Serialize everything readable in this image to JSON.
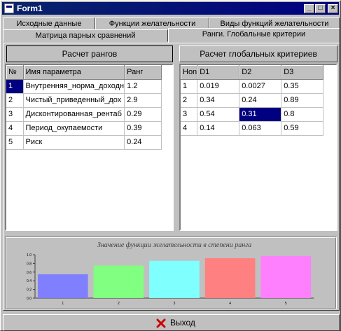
{
  "window": {
    "title": "Form1"
  },
  "title_buttons": {
    "minimize": "_",
    "maximize": "□",
    "close": "×"
  },
  "tabs_row1": [
    "Исходные данные",
    "Функции желательности",
    "Виды функций желательности"
  ],
  "tabs_row2": [
    "Матрица парных сравнений",
    "Ранги. Глобальные критерии"
  ],
  "active_tab": "Ранги. Глобальные критерии",
  "buttons": {
    "calc_ranks": "Расчет рангов",
    "calc_global": "Расчет глобальных критериев",
    "exit": "Выход"
  },
  "left_grid": {
    "headers": [
      "№",
      "Имя параметра",
      "Ранг"
    ],
    "rows": [
      [
        "1",
        "Внутренняя_норма_доходн",
        "1.2"
      ],
      [
        "2",
        "Чистый_приведенный_дох",
        "2.9"
      ],
      [
        "3",
        "Дисконтированная_рентаб",
        "0.29"
      ],
      [
        "4",
        "Период_окупаемости",
        "0.39"
      ],
      [
        "5",
        "Риск",
        "0.24"
      ]
    ]
  },
  "right_grid": {
    "headers": [
      "Hon",
      "D1",
      "D2",
      "D3"
    ],
    "rows": [
      [
        "1",
        "0.019",
        "0.0027",
        "0.35"
      ],
      [
        "2",
        "0.34",
        "0.24",
        "0.89"
      ],
      [
        "3",
        "0.54",
        "0.31",
        "0.8"
      ],
      [
        "4",
        "0.14",
        "0.063",
        "0.59"
      ]
    ],
    "selected_cell": {
      "row": 2,
      "col": 2
    }
  },
  "chart_data": {
    "type": "bar",
    "title": "Значение функции желательности в степени ранга",
    "categories": [
      "1",
      "2",
      "3",
      "4",
      "5"
    ],
    "values": [
      0.55,
      0.75,
      0.86,
      0.92,
      0.97
    ],
    "colors": [
      "#8080ff",
      "#80ff80",
      "#80ffff",
      "#ff8080",
      "#ff80ff"
    ],
    "ylim": [
      0,
      1.0
    ],
    "yticks": [
      "0.0",
      "0.2",
      "0.4",
      "0.6",
      "0.8",
      "1.0"
    ],
    "grid": false,
    "legend": "none"
  },
  "colors": {
    "selection": "#000080",
    "face": "#c0c0c0",
    "exit_icon": "#cc0000"
  }
}
